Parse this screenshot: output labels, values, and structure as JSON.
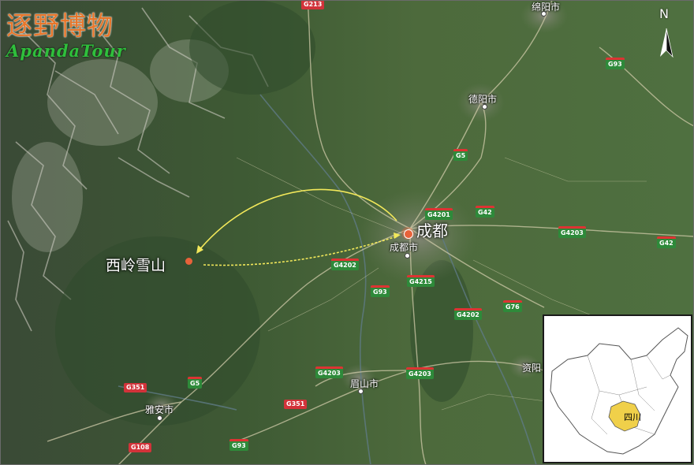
{
  "logo": {
    "chinese": "逐野博物",
    "english": "ApandaTour"
  },
  "compass": {
    "letter": "N"
  },
  "destinations": {
    "chengdu": {
      "label": "成都",
      "marker_color": "#e8623a"
    },
    "xiling": {
      "label": "西岭雪山",
      "marker_color": "#e8623a"
    }
  },
  "route_color": "#f2e85a",
  "cities": {
    "mianyang": "绵阳市",
    "deyang": "德阳市",
    "chengdu_shi": "成都市",
    "meishan": "眉山市",
    "yaan": "雅安市",
    "ziyang": "资阳"
  },
  "roads": {
    "g93_top": "G93",
    "g5_north": "G5",
    "g4201": "G4201",
    "g42_a": "G42",
    "g4203_east": "G4203",
    "g42_b": "G42",
    "g4202_west": "G4202",
    "g4215": "G4215",
    "g93_mid": "G93",
    "g4202_south": "G4202",
    "g76": "G76",
    "g4203_a": "G4203",
    "g4203_b": "G4203",
    "g5_south": "G5",
    "g351_a": "G351",
    "g351_b": "G351",
    "g93_bottom": "G93",
    "g108": "G108",
    "g213_top": "G213"
  },
  "inset": {
    "province_label": "四川",
    "highlight_color": "#f0d04a"
  }
}
